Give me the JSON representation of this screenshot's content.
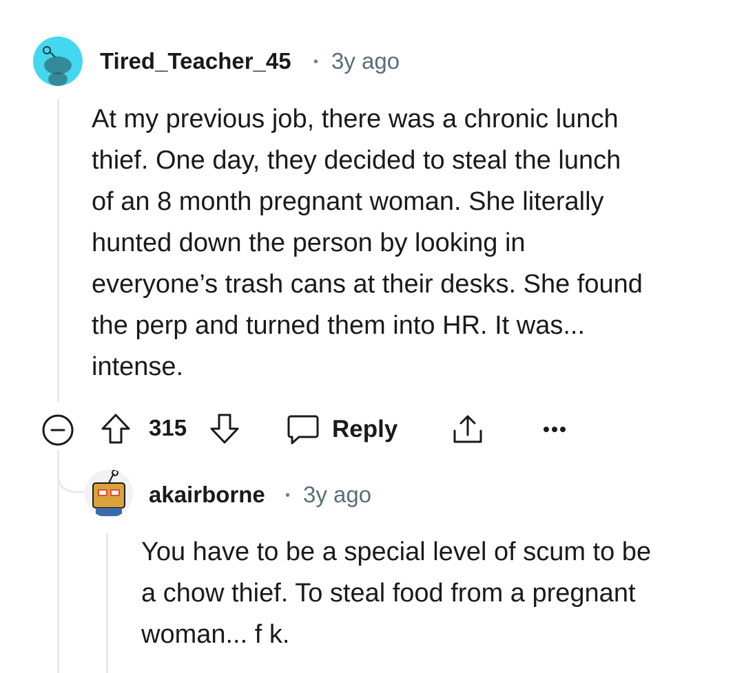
{
  "comment": {
    "username": "Tired_Teacher_45",
    "separator": "•",
    "time": "3y ago",
    "body_lines": [
      "At my previous job, there was a chronic lunch",
      "thief. One day, they decided to steal the lunch",
      "of an 8 month pregnant woman. She literally",
      "hunted down the person by looking in",
      "everyone’s trash cans at their desks. She found",
      "the perp and turned them into HR. It was...",
      "intense."
    ],
    "actions": {
      "score": "315",
      "reply_label": "Reply",
      "more_icon": "more-dots-icon",
      "collapse_icon": "collapse-minus-icon",
      "upvote_icon": "upvote-arrow-icon",
      "downvote_icon": "downvote-arrow-icon",
      "reply_icon": "speech-bubble-icon",
      "share_icon": "share-upload-icon"
    }
  },
  "reply": {
    "username": "akairborne",
    "separator": "•",
    "time": "3y ago",
    "body_lines": [
      "You have to be a special level of scum to be",
      "a chow thief. To steal food from a pregnant",
      "woman... f k."
    ]
  },
  "colors": {
    "avatar_bg": "#44d7f0",
    "thread_line": "#e8e9eb",
    "meta_gray": "#576f76"
  }
}
